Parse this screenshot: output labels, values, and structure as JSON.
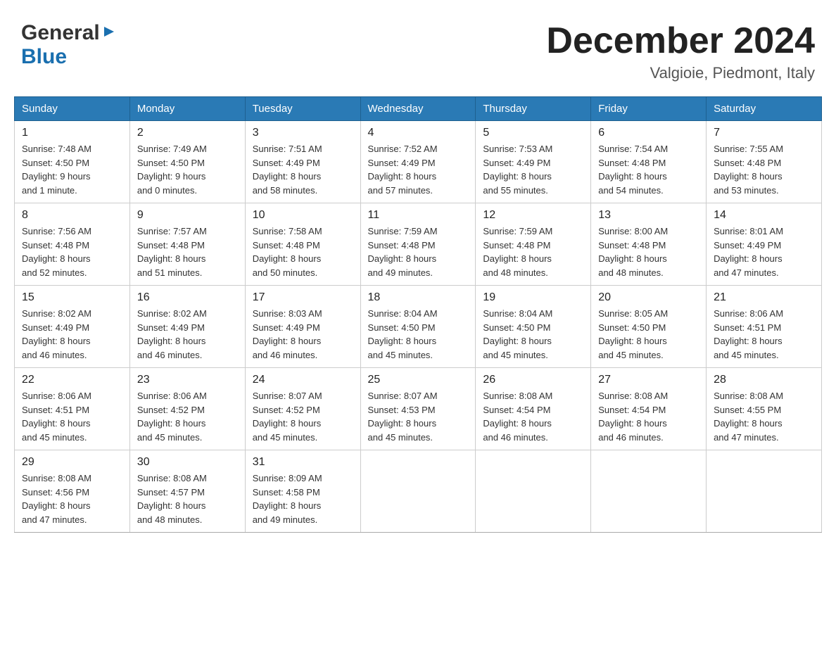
{
  "header": {
    "logo_general": "General",
    "logo_blue": "Blue",
    "month_title": "December 2024",
    "location": "Valgioie, Piedmont, Italy"
  },
  "days_of_week": [
    "Sunday",
    "Monday",
    "Tuesday",
    "Wednesday",
    "Thursday",
    "Friday",
    "Saturday"
  ],
  "weeks": [
    [
      {
        "day": "1",
        "sunrise": "7:48 AM",
        "sunset": "4:50 PM",
        "daylight": "9 hours and 1 minute."
      },
      {
        "day": "2",
        "sunrise": "7:49 AM",
        "sunset": "4:50 PM",
        "daylight": "9 hours and 0 minutes."
      },
      {
        "day": "3",
        "sunrise": "7:51 AM",
        "sunset": "4:49 PM",
        "daylight": "8 hours and 58 minutes."
      },
      {
        "day": "4",
        "sunrise": "7:52 AM",
        "sunset": "4:49 PM",
        "daylight": "8 hours and 57 minutes."
      },
      {
        "day": "5",
        "sunrise": "7:53 AM",
        "sunset": "4:49 PM",
        "daylight": "8 hours and 55 minutes."
      },
      {
        "day": "6",
        "sunrise": "7:54 AM",
        "sunset": "4:48 PM",
        "daylight": "8 hours and 54 minutes."
      },
      {
        "day": "7",
        "sunrise": "7:55 AM",
        "sunset": "4:48 PM",
        "daylight": "8 hours and 53 minutes."
      }
    ],
    [
      {
        "day": "8",
        "sunrise": "7:56 AM",
        "sunset": "4:48 PM",
        "daylight": "8 hours and 52 minutes."
      },
      {
        "day": "9",
        "sunrise": "7:57 AM",
        "sunset": "4:48 PM",
        "daylight": "8 hours and 51 minutes."
      },
      {
        "day": "10",
        "sunrise": "7:58 AM",
        "sunset": "4:48 PM",
        "daylight": "8 hours and 50 minutes."
      },
      {
        "day": "11",
        "sunrise": "7:59 AM",
        "sunset": "4:48 PM",
        "daylight": "8 hours and 49 minutes."
      },
      {
        "day": "12",
        "sunrise": "7:59 AM",
        "sunset": "4:48 PM",
        "daylight": "8 hours and 48 minutes."
      },
      {
        "day": "13",
        "sunrise": "8:00 AM",
        "sunset": "4:48 PM",
        "daylight": "8 hours and 48 minutes."
      },
      {
        "day": "14",
        "sunrise": "8:01 AM",
        "sunset": "4:49 PM",
        "daylight": "8 hours and 47 minutes."
      }
    ],
    [
      {
        "day": "15",
        "sunrise": "8:02 AM",
        "sunset": "4:49 PM",
        "daylight": "8 hours and 46 minutes."
      },
      {
        "day": "16",
        "sunrise": "8:02 AM",
        "sunset": "4:49 PM",
        "daylight": "8 hours and 46 minutes."
      },
      {
        "day": "17",
        "sunrise": "8:03 AM",
        "sunset": "4:49 PM",
        "daylight": "8 hours and 46 minutes."
      },
      {
        "day": "18",
        "sunrise": "8:04 AM",
        "sunset": "4:50 PM",
        "daylight": "8 hours and 45 minutes."
      },
      {
        "day": "19",
        "sunrise": "8:04 AM",
        "sunset": "4:50 PM",
        "daylight": "8 hours and 45 minutes."
      },
      {
        "day": "20",
        "sunrise": "8:05 AM",
        "sunset": "4:50 PM",
        "daylight": "8 hours and 45 minutes."
      },
      {
        "day": "21",
        "sunrise": "8:06 AM",
        "sunset": "4:51 PM",
        "daylight": "8 hours and 45 minutes."
      }
    ],
    [
      {
        "day": "22",
        "sunrise": "8:06 AM",
        "sunset": "4:51 PM",
        "daylight": "8 hours and 45 minutes."
      },
      {
        "day": "23",
        "sunrise": "8:06 AM",
        "sunset": "4:52 PM",
        "daylight": "8 hours and 45 minutes."
      },
      {
        "day": "24",
        "sunrise": "8:07 AM",
        "sunset": "4:52 PM",
        "daylight": "8 hours and 45 minutes."
      },
      {
        "day": "25",
        "sunrise": "8:07 AM",
        "sunset": "4:53 PM",
        "daylight": "8 hours and 45 minutes."
      },
      {
        "day": "26",
        "sunrise": "8:08 AM",
        "sunset": "4:54 PM",
        "daylight": "8 hours and 46 minutes."
      },
      {
        "day": "27",
        "sunrise": "8:08 AM",
        "sunset": "4:54 PM",
        "daylight": "8 hours and 46 minutes."
      },
      {
        "day": "28",
        "sunrise": "8:08 AM",
        "sunset": "4:55 PM",
        "daylight": "8 hours and 47 minutes."
      }
    ],
    [
      {
        "day": "29",
        "sunrise": "8:08 AM",
        "sunset": "4:56 PM",
        "daylight": "8 hours and 47 minutes."
      },
      {
        "day": "30",
        "sunrise": "8:08 AM",
        "sunset": "4:57 PM",
        "daylight": "8 hours and 48 minutes."
      },
      {
        "day": "31",
        "sunrise": "8:09 AM",
        "sunset": "4:58 PM",
        "daylight": "8 hours and 49 minutes."
      },
      null,
      null,
      null,
      null
    ]
  ],
  "labels": {
    "sunrise": "Sunrise:",
    "sunset": "Sunset:",
    "daylight": "Daylight:"
  }
}
